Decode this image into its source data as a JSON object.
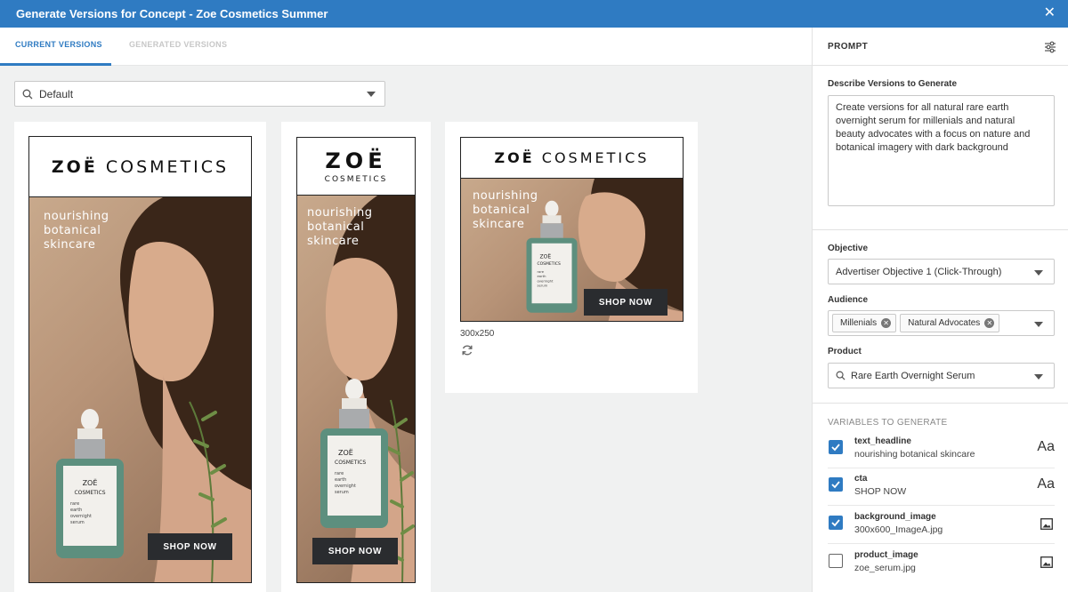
{
  "window": {
    "title": "Generate Versions for Concept - Zoe Cosmetics Summer",
    "close_icon": "close-icon"
  },
  "tabs": [
    {
      "label": "CURRENT VERSIONS",
      "active": true
    },
    {
      "label": "GENERATED VERSIONS",
      "active": false
    }
  ],
  "filter": {
    "value": "Default",
    "icon": "search-icon"
  },
  "ads": [
    {
      "brand_main": "ZOË",
      "brand_sub": "COSMETICS",
      "headline": [
        "nourishing",
        "botanical",
        "skincare"
      ],
      "cta": "SHOP NOW",
      "bottle_brand": [
        "ZOË",
        "COSMETICS"
      ],
      "bottle_text": [
        "rare",
        "earth",
        "overnight",
        "serum"
      ]
    },
    {
      "brand_main": "ZOË",
      "brand_sub": "COSMETICS",
      "headline": [
        "nourishing",
        "botanical",
        "skincare"
      ],
      "cta": "SHOP NOW",
      "bottle_brand": [
        "ZOË",
        "COSMETICS"
      ],
      "bottle_text": [
        "rare",
        "earth",
        "overnight",
        "serum"
      ]
    },
    {
      "brand_main": "ZOË",
      "brand_sub": "COSMETICS",
      "headline": [
        "nourishing",
        "botanical",
        "skincare"
      ],
      "cta": "SHOP NOW",
      "size": "300x250",
      "bottle_brand": [
        "ZOË",
        "COSMETICS"
      ],
      "bottle_text": [
        "rare",
        "earth",
        "overnight",
        "serum"
      ]
    }
  ],
  "prompt": {
    "header": "PROMPT",
    "describe_label": "Describe Versions to Generate",
    "describe_value": "Create versions for all natural rare earth overnight serum for millenials and natural beauty advocates with a focus on nature and botanical imagery with dark background",
    "objective_label": "Objective",
    "objective_value": "Advertiser Objective 1 (Click-Through)",
    "audience_label": "Audience",
    "audience_chips": [
      "Millenials",
      "Natural Advocates"
    ],
    "product_label": "Product",
    "product_value": "Rare Earth Overnight Serum",
    "vars_title": "VARIABLES TO GENERATE",
    "variables": [
      {
        "name": "text_headline",
        "value": "nourishing botanical skincare",
        "checked": true,
        "kind": "Aa"
      },
      {
        "name": "cta",
        "value": "SHOP NOW",
        "checked": true,
        "kind": "Aa"
      },
      {
        "name": "background_image",
        "value": "300x600_ImageA.jpg",
        "checked": true,
        "kind": "image-icon"
      },
      {
        "name": "product_image",
        "value": "zoe_serum.jpg",
        "checked": false,
        "kind": "image-icon"
      }
    ]
  },
  "colors": {
    "accent": "#2f7bc2",
    "cta_bg": "#2a2c2f"
  }
}
